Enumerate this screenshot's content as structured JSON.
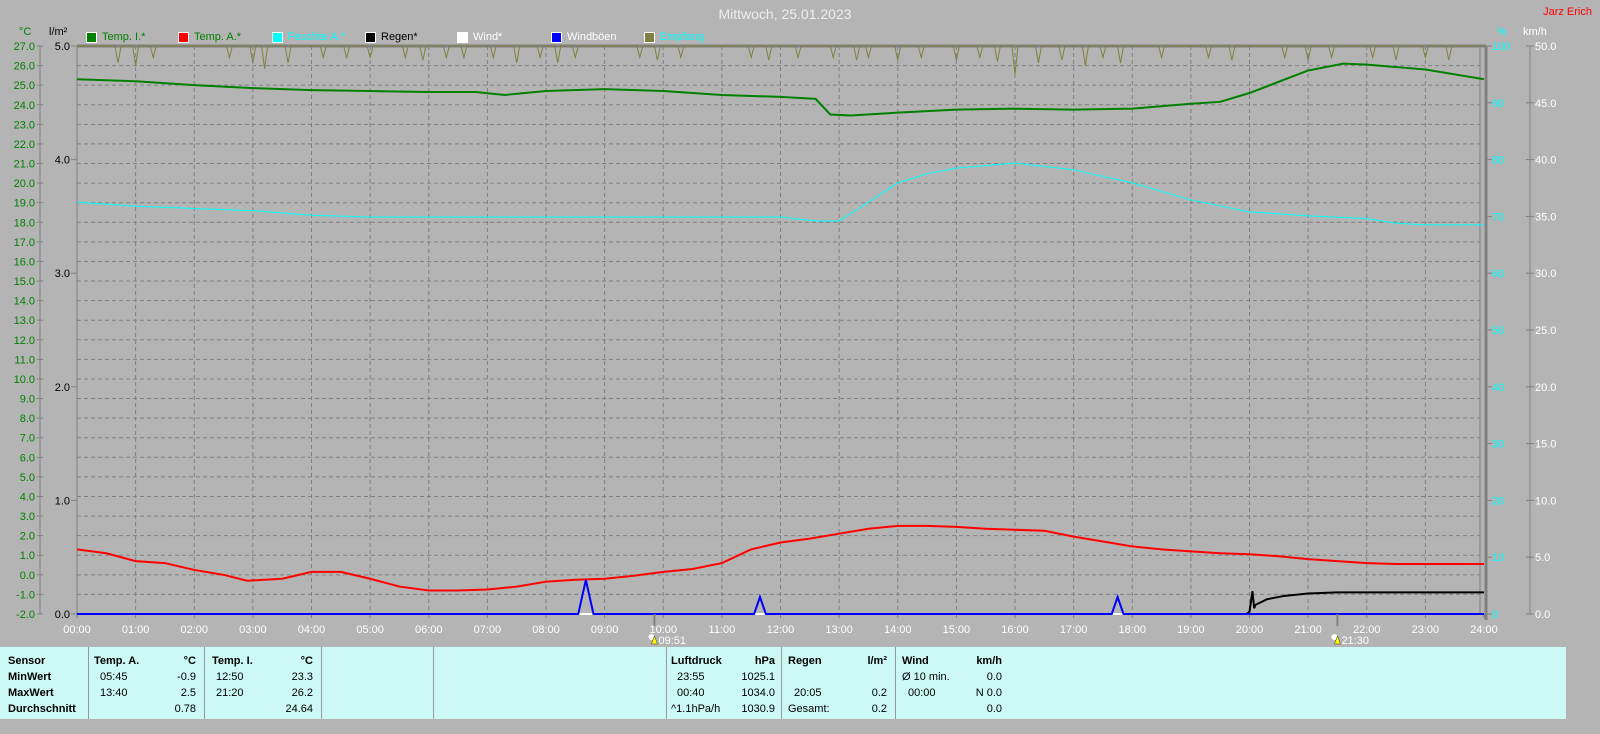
{
  "header": {
    "title": "Mittwoch, 25.01.2023",
    "user": "Jarz Erich"
  },
  "legend": [
    {
      "label": "Temp. I.*",
      "color": "#008000",
      "text_color": "#008000"
    },
    {
      "label": "Temp. A.*",
      "color": "#ff0000",
      "text_color": "#008000"
    },
    {
      "label": "Feuchte A.*",
      "color": "#00ffff",
      "text_color": "#00ffff"
    },
    {
      "label": "Regen*",
      "color": "#000000",
      "text_color": "#000000"
    },
    {
      "label": "Wind*",
      "color": "#ffffff",
      "text_color": "#ffffff"
    },
    {
      "label": "Windböen",
      "color": "#0000ff",
      "text_color": "#ffffff"
    },
    {
      "label": "Empfang",
      "color": "#808040",
      "text_color": "#00ffff"
    }
  ],
  "chart_data": {
    "type": "line",
    "title": "Mittwoch, 25.01.2023",
    "x_unit": "hours",
    "x_range": [
      0,
      24
    ],
    "x_ticks": [
      "00:00",
      "01:00",
      "02:00",
      "03:00",
      "04:00",
      "05:00",
      "06:00",
      "07:00",
      "08:00",
      "09:00",
      "10:00",
      "11:00",
      "12:00",
      "13:00",
      "14:00",
      "15:00",
      "16:00",
      "17:00",
      "18:00",
      "19:00",
      "20:00",
      "21:00",
      "22:00",
      "23:00",
      "24:00"
    ],
    "axes": {
      "temp": {
        "label": "°C",
        "range": [
          -2.0,
          27.0
        ],
        "ticks": [
          "27.0",
          "26.0",
          "25.0",
          "24.0",
          "23.0",
          "22.0",
          "21.0",
          "20.0",
          "19.0",
          "18.0",
          "17.0",
          "16.0",
          "15.0",
          "14.0",
          "13.0",
          "12.0",
          "11.0",
          "10.0",
          "9.0",
          "8.0",
          "7.0",
          "6.0",
          "5.0",
          "4.0",
          "3.0",
          "2.0",
          "1.0",
          "0.0",
          "-1.0",
          "-2.0"
        ]
      },
      "rain": {
        "label": "l/m²",
        "range": [
          0,
          5
        ],
        "ticks": [
          "5.0",
          "4.0",
          "3.0",
          "2.0",
          "1.0",
          "0.0"
        ]
      },
      "humidity": {
        "label": "%",
        "range": [
          0,
          100
        ],
        "ticks": [
          "100",
          "90",
          "80",
          "70",
          "60",
          "50",
          "40",
          "30",
          "20",
          "10",
          "0"
        ]
      },
      "wind": {
        "label": "km/h",
        "range": [
          0,
          50
        ],
        "ticks": [
          "50.0",
          "45.0",
          "40.0",
          "35.0",
          "30.0",
          "25.0",
          "20.0",
          "15.0",
          "10.0",
          "5.0",
          "0.0"
        ]
      }
    },
    "grid": true,
    "series": [
      {
        "name": "Temp. I.*",
        "axis": "temp",
        "color": "#008000",
        "x": [
          0,
          1,
          2,
          3,
          4,
          5,
          6,
          6.8,
          7.3,
          8,
          9,
          10,
          11,
          12,
          12.6,
          12.85,
          13.2,
          14,
          15,
          16,
          17,
          18,
          19,
          19.5,
          20,
          21,
          21.6,
          22,
          23,
          24
        ],
        "y": [
          25.3,
          25.2,
          25.0,
          24.85,
          24.75,
          24.7,
          24.65,
          24.65,
          24.5,
          24.7,
          24.8,
          24.7,
          24.5,
          24.4,
          24.3,
          23.5,
          23.45,
          23.6,
          23.75,
          23.8,
          23.75,
          23.8,
          24.05,
          24.15,
          24.6,
          25.75,
          26.1,
          26.05,
          25.8,
          25.3
        ]
      },
      {
        "name": "Temp. A.*",
        "axis": "temp",
        "color": "#ff0000",
        "x": [
          0,
          0.5,
          1,
          1.5,
          2,
          2.5,
          2.9,
          3.5,
          4,
          4.5,
          5,
          5.5,
          6,
          6.5,
          7,
          7.5,
          8,
          8.5,
          9,
          9.5,
          10,
          10.5,
          11,
          11.5,
          12,
          12.5,
          13,
          13.5,
          14,
          14.5,
          15,
          15.5,
          16,
          16.5,
          17,
          17.5,
          18,
          18.5,
          19,
          19.5,
          20,
          20.5,
          21,
          21.5,
          22,
          22.5,
          23,
          23.5,
          24
        ],
        "y": [
          1.3,
          1.1,
          0.7,
          0.6,
          0.25,
          0.0,
          -0.3,
          -0.2,
          0.15,
          0.15,
          -0.2,
          -0.6,
          -0.8,
          -0.8,
          -0.75,
          -0.6,
          -0.35,
          -0.25,
          -0.2,
          -0.05,
          0.15,
          0.3,
          0.6,
          1.3,
          1.65,
          1.85,
          2.1,
          2.35,
          2.5,
          2.5,
          2.45,
          2.35,
          2.3,
          2.25,
          1.95,
          1.7,
          1.45,
          1.3,
          1.2,
          1.1,
          1.05,
          0.95,
          0.8,
          0.7,
          0.6,
          0.55,
          0.55,
          0.55,
          0.55
        ]
      },
      {
        "name": "Feuchte A.*",
        "axis": "humidity",
        "color": "#00ffff",
        "x": [
          0,
          1,
          2,
          3,
          4,
          5,
          6,
          7,
          8,
          9,
          10,
          11,
          12,
          12.6,
          13,
          13.5,
          14,
          14.5,
          15,
          16,
          17,
          18,
          19,
          20,
          21,
          22,
          22.5,
          23,
          24
        ],
        "y": [
          72.5,
          71.8,
          71.4,
          71.0,
          70.2,
          69.9,
          69.9,
          69.9,
          69.9,
          69.9,
          69.9,
          69.9,
          69.9,
          69.2,
          69.2,
          72.5,
          75.9,
          77.5,
          78.5,
          79.4,
          78.2,
          75.9,
          72.9,
          70.8,
          70.1,
          69.6,
          68.8,
          68.5,
          68.5
        ]
      },
      {
        "name": "Regen*",
        "axis": "rain",
        "color": "#000000",
        "x": [
          0,
          19.95,
          20.0,
          20.05,
          20.08,
          20.1,
          20.3,
          20.6,
          21.0,
          21.5,
          22,
          24
        ],
        "y": [
          0,
          0,
          0.02,
          0.2,
          0.05,
          0.08,
          0.13,
          0.16,
          0.18,
          0.19,
          0.19,
          0.19
        ]
      },
      {
        "name": "Wind*",
        "axis": "wind",
        "color": "#ffffff",
        "x": [
          0,
          24
        ],
        "y": [
          0,
          0
        ]
      },
      {
        "name": "Windböen",
        "axis": "wind",
        "color": "#0000ff",
        "x": [
          0,
          8.55,
          8.68,
          8.81,
          11.55,
          11.65,
          11.75,
          17.65,
          17.75,
          17.85,
          24
        ],
        "y": [
          0,
          0,
          3.0,
          0,
          0,
          1.5,
          0,
          0,
          1.5,
          0,
          0
        ]
      },
      {
        "name": "Empfang",
        "axis": "humidity",
        "color": "#808040",
        "dips": [
          [
            0.7,
            97
          ],
          [
            1.0,
            96.5
          ],
          [
            1.3,
            98
          ],
          [
            2.6,
            98
          ],
          [
            3.0,
            97
          ],
          [
            3.2,
            96
          ],
          [
            3.6,
            97
          ],
          [
            4.2,
            98
          ],
          [
            4.6,
            97.8
          ],
          [
            5.0,
            98
          ],
          [
            5.6,
            98
          ],
          [
            5.9,
            97.5
          ],
          [
            6.3,
            98
          ],
          [
            6.6,
            98
          ],
          [
            7.1,
            98
          ],
          [
            7.5,
            97
          ],
          [
            7.9,
            98
          ],
          [
            8.2,
            97
          ],
          [
            8.5,
            98
          ],
          [
            9.6,
            98
          ],
          [
            9.9,
            97.5
          ],
          [
            10.3,
            98
          ],
          [
            11.5,
            98
          ],
          [
            11.8,
            97.5
          ],
          [
            12.3,
            98
          ],
          [
            12.9,
            98
          ],
          [
            13.3,
            97.5
          ],
          [
            13.5,
            98
          ],
          [
            14.0,
            97.5
          ],
          [
            14.4,
            98
          ],
          [
            15.0,
            97.5
          ],
          [
            15.4,
            98
          ],
          [
            15.7,
            97.3
          ],
          [
            16.0,
            95
          ],
          [
            16.4,
            97
          ],
          [
            16.8,
            97.5
          ],
          [
            17.2,
            96.5
          ],
          [
            17.5,
            98
          ],
          [
            17.8,
            97
          ],
          [
            18.5,
            98
          ],
          [
            19.3,
            98
          ],
          [
            19.7,
            97.5
          ],
          [
            20.6,
            98
          ],
          [
            21.0,
            97.5
          ],
          [
            21.4,
            98
          ],
          [
            22.1,
            98
          ],
          [
            22.5,
            97.5
          ],
          [
            23.0,
            98
          ],
          [
            23.4,
            97.5
          ]
        ]
      }
    ],
    "markers": [
      {
        "label": "09:51",
        "time": 9.85,
        "type": "sunrise"
      },
      {
        "label": "21:30",
        "time": 21.5,
        "type": "sunset"
      }
    ]
  },
  "table": {
    "sensor": {
      "header": "Sensor",
      "rows": [
        "MinWert",
        "MaxWert",
        "Durchschnitt"
      ]
    },
    "temp_a": {
      "header": "Temp. A.",
      "unit": "°C",
      "min_time": "05:45",
      "min": "-0.9",
      "max_time": "13:40",
      "max": "2.5",
      "avg": "0.78"
    },
    "temp_i": {
      "header": "Temp. I.",
      "unit": "°C",
      "min_time": "12:50",
      "min": "23.3",
      "max_time": "21:20",
      "max": "26.2",
      "avg": "24.64"
    },
    "luftdruck": {
      "header": "Luftdruck",
      "unit": "hPa",
      "min_time": "23:55",
      "min": "1025.1",
      "max_time": "00:40",
      "max": "1034.0",
      "trend": "^1.1hPa/h",
      "avg": "1030.9"
    },
    "regen": {
      "header": "Regen",
      "unit": "l/m²",
      "max_time": "20:05",
      "max": "0.2",
      "total_label": "Gesamt:",
      "total": "0.2"
    },
    "wind": {
      "header": "Wind",
      "unit": "km/h",
      "r1_label": "Ø 10 min.",
      "r1": "0.0",
      "r2_label": "00:00",
      "r2": "N 0.0",
      "r3": "0.0"
    }
  }
}
